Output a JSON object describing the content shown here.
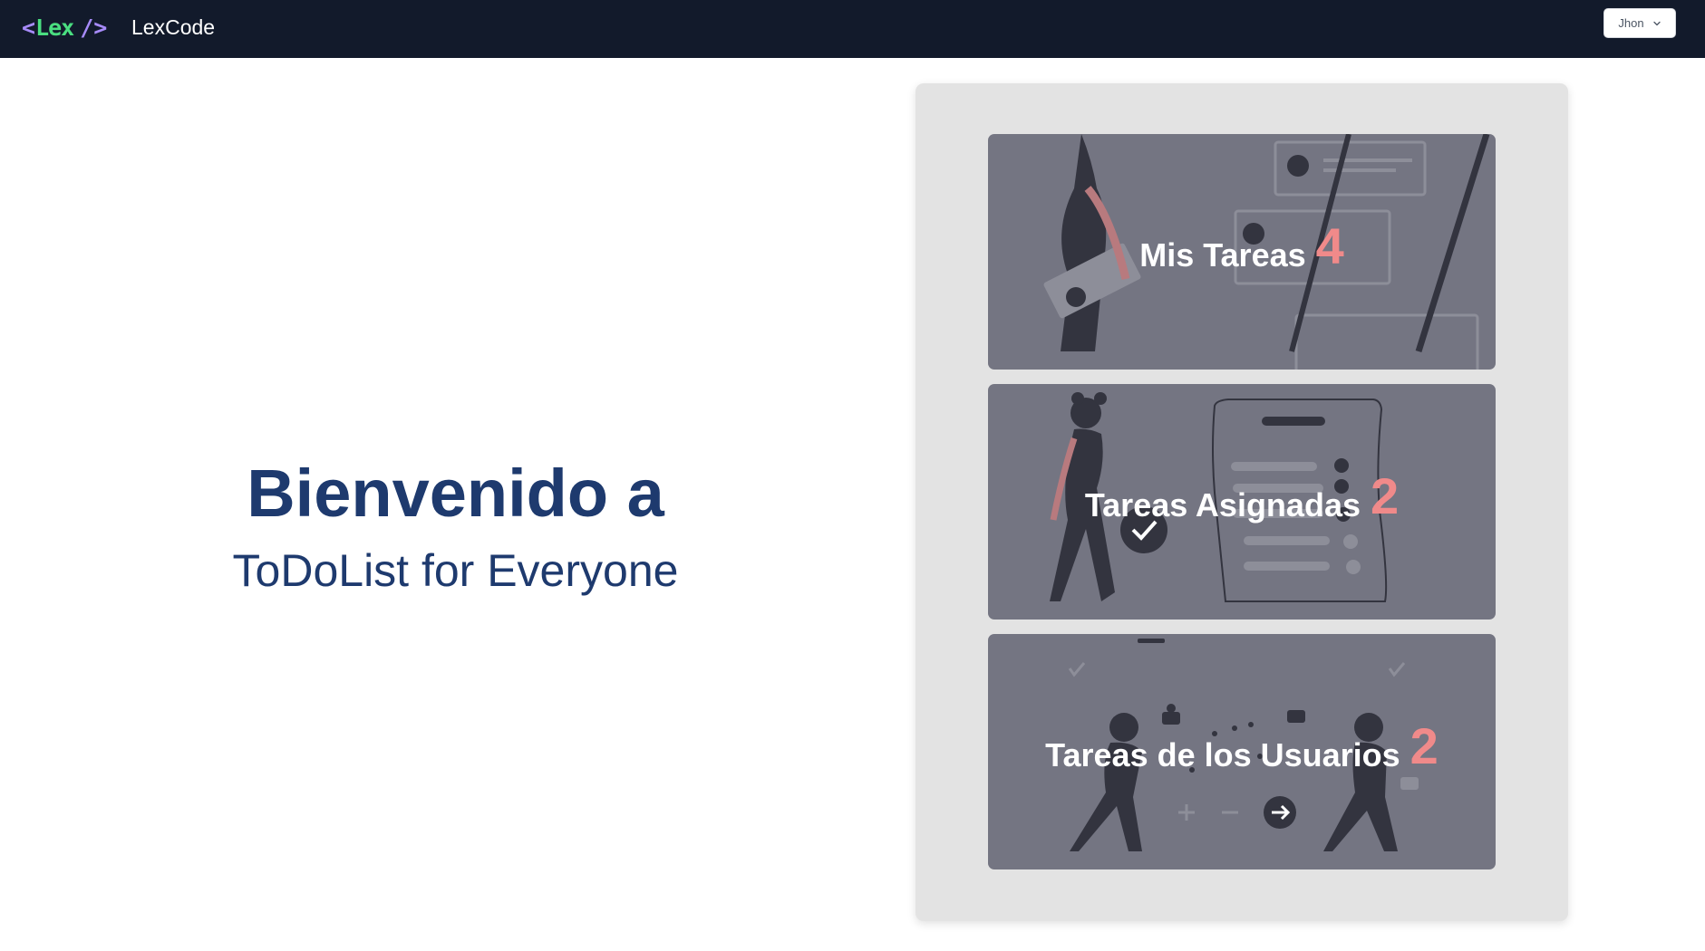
{
  "navbar": {
    "logo": {
      "open": "<",
      "word": "Lex",
      "close": "/>"
    },
    "brand": "LexCode",
    "user_menu": {
      "label": "Jhon",
      "icon": "chevron-down-icon"
    }
  },
  "welcome": {
    "title": "Bienvenido a",
    "subtitle": "ToDoList for Everyone"
  },
  "cards": [
    {
      "title": "Mis Tareas",
      "count": "4"
    },
    {
      "title": "Tareas Asignadas",
      "count": "2"
    },
    {
      "title": "Tareas de los Usuarios",
      "count": "2"
    }
  ],
  "colors": {
    "navbar_bg": "#121a2b",
    "logo_accent": "#a78bfa",
    "logo_word": "#4ade80",
    "heading_text": "#1e3a6e",
    "card_bg": "#747582",
    "count_accent": "#f08a8a",
    "panel_bg": "#e3e3e3"
  }
}
